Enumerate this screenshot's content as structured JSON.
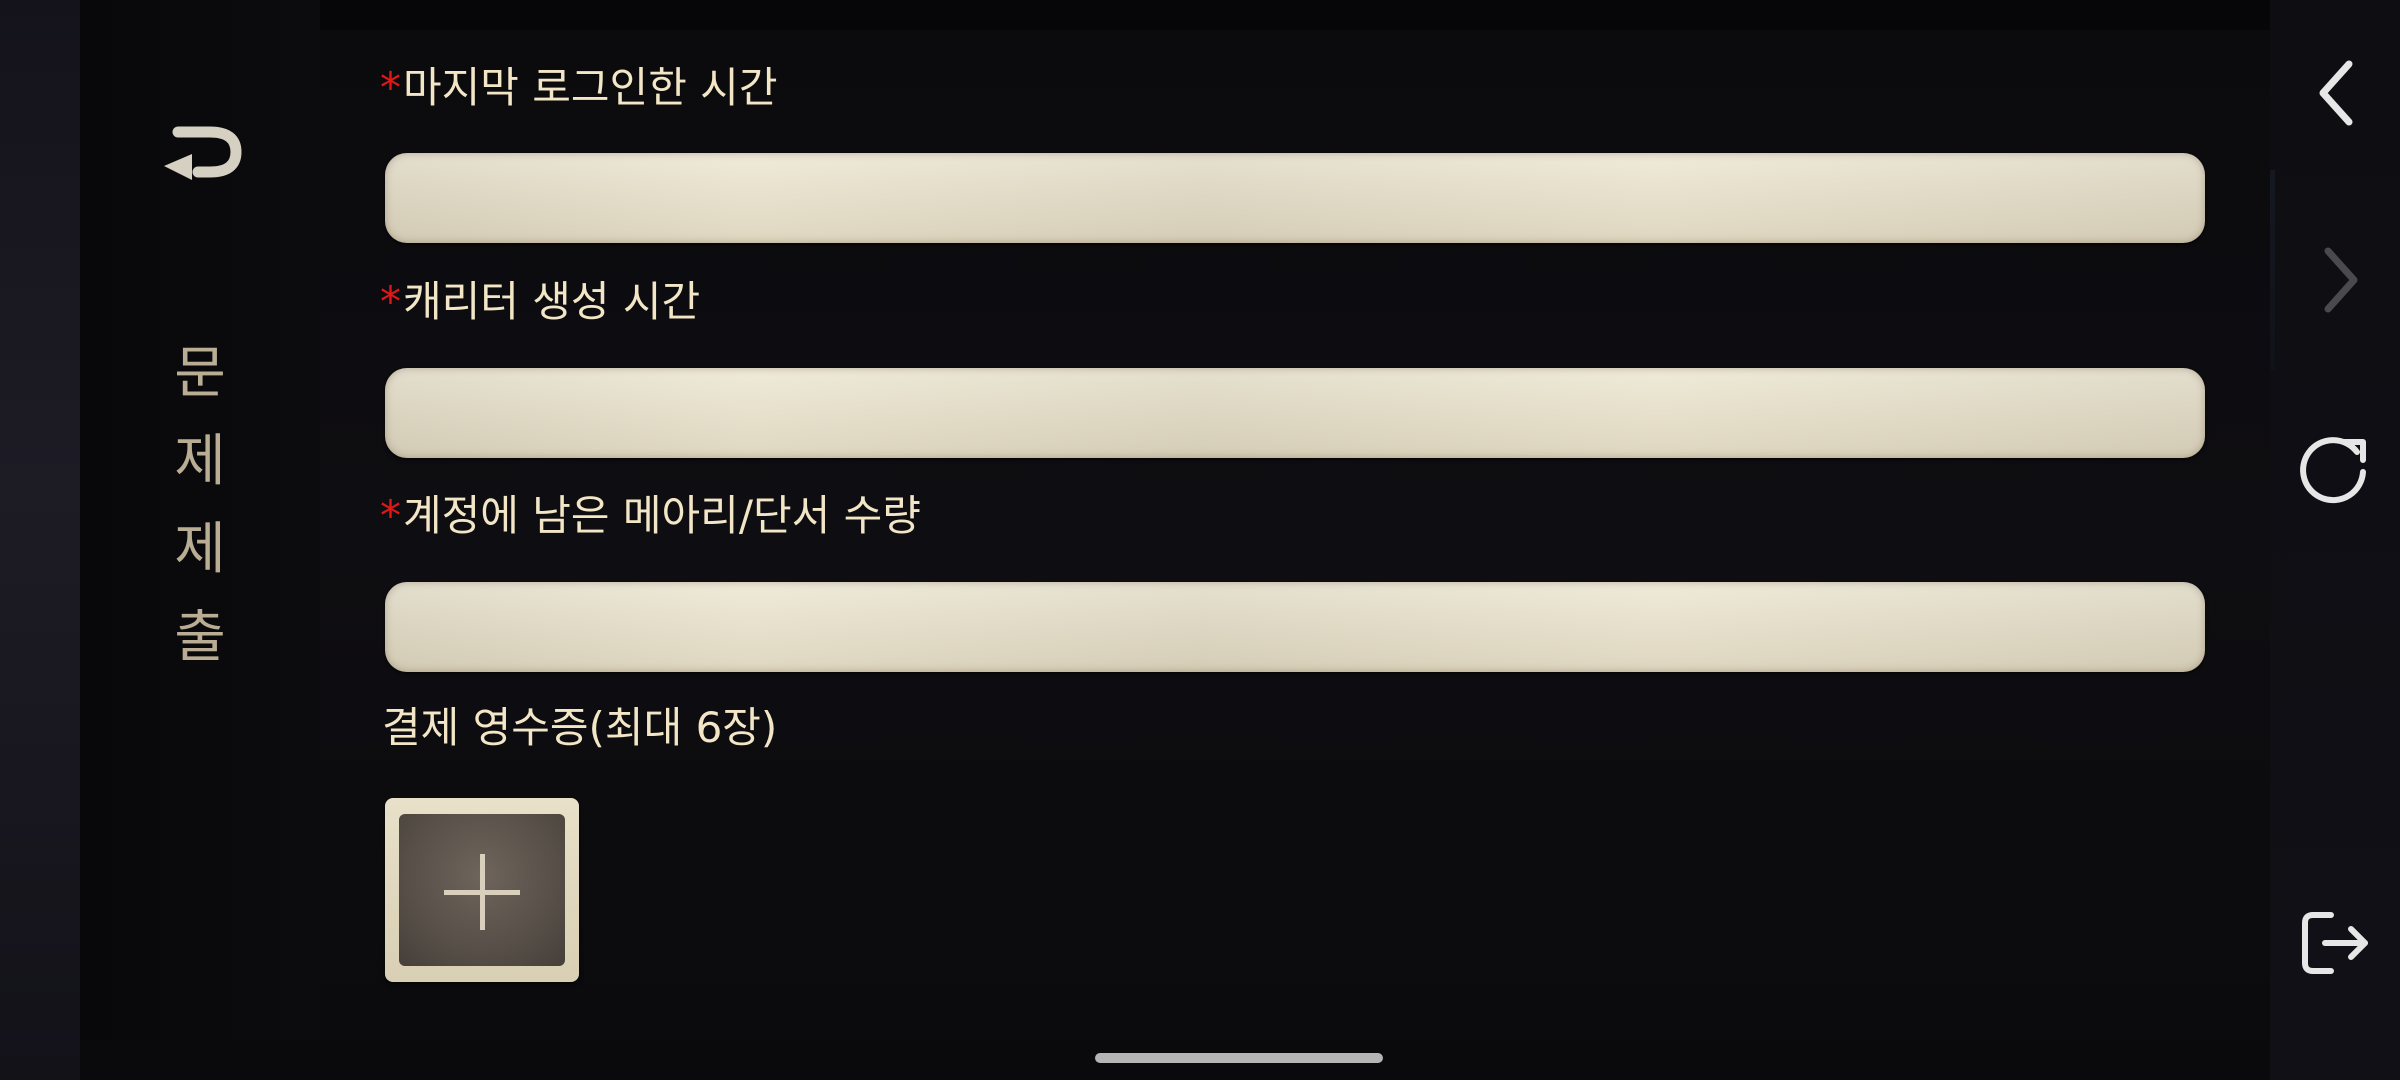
{
  "side_menu": {
    "title_chars": [
      "문",
      "제",
      "제",
      "출"
    ]
  },
  "form": {
    "fields": [
      {
        "required_mark": "*",
        "label": "마지막 로그인한 시간",
        "value": "",
        "placeholder": ""
      },
      {
        "required_mark": "*",
        "label": "캐리터 생성 시간",
        "value": "",
        "placeholder": ""
      },
      {
        "required_mark": "*",
        "label": "계정에 남은 메아리/단서 수량",
        "value": "",
        "placeholder": ""
      }
    ],
    "receipt_label": "결제 영수증(최대 6장)"
  },
  "icons": {
    "back": "return-arrow-icon",
    "prev": "chevron-left-icon",
    "next": "chevron-right-icon",
    "refresh": "refresh-icon",
    "exit": "exit-icon",
    "add": "plus-icon"
  },
  "colors": {
    "label": "#f2e6c6",
    "required": "#e01818",
    "title": "#b9ad93",
    "paper": "#e6dfca",
    "nav_icon": "#e0e0e0",
    "nav_icon_disabled": "#4a4a4e"
  }
}
